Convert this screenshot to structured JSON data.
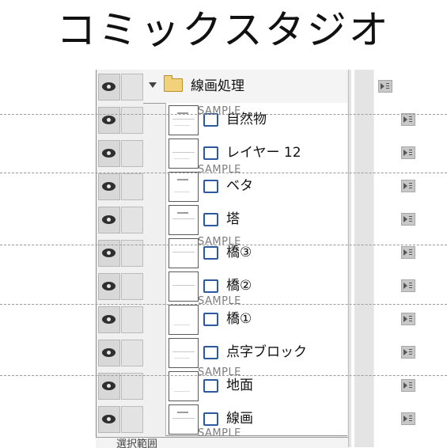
{
  "title": "コミックスタジオ",
  "panel": {
    "folder": {
      "name": "線画処理"
    },
    "layers": [
      {
        "name": "自然物"
      },
      {
        "name": "レイヤー 12"
      },
      {
        "name": "ベタ"
      },
      {
        "name": "塔"
      },
      {
        "name": "橋③"
      },
      {
        "name": "橋②"
      },
      {
        "name": "橋①"
      },
      {
        "name": "点字ブロック"
      },
      {
        "name": "地面"
      },
      {
        "name": "線画"
      }
    ],
    "bottom_partial": "選択範囲"
  },
  "watermark": "SAMPLE",
  "colors": {
    "layer_icon_blue": "#2c5aa0",
    "folder_yellow": "#f1d27a",
    "panel_gray": "#f0f0f0"
  },
  "icons": [
    "eye-icon",
    "lock-toggle",
    "folder-icon",
    "layer-icon",
    "layer-properties-icon",
    "expand-toggle-icon"
  ]
}
